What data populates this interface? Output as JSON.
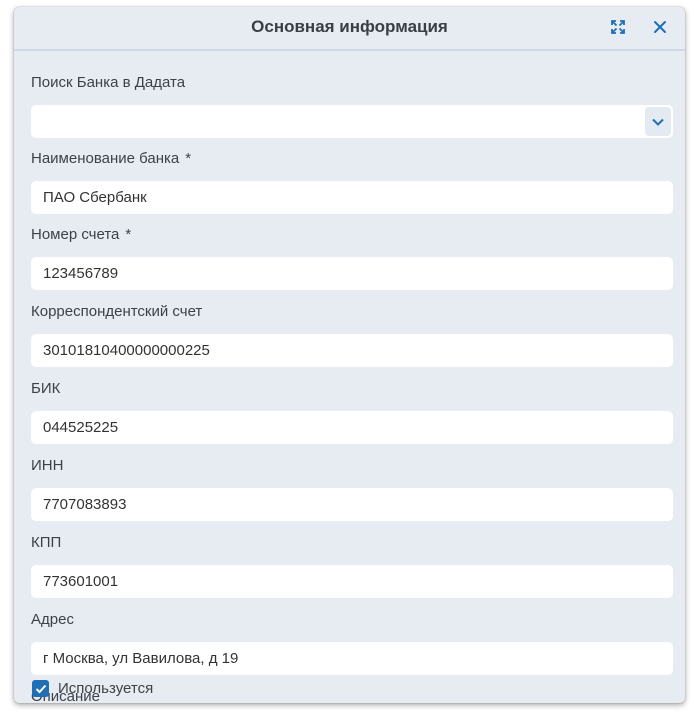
{
  "dialog": {
    "title": "Основная информация"
  },
  "form": {
    "bank_search": {
      "label": "Поиск Банка в Дадата",
      "value": ""
    },
    "bank_name": {
      "label": "Наименование банка",
      "required_mark": "*",
      "value": "ПАО Сбербанк"
    },
    "account_number": {
      "label": "Номер счета",
      "required_mark": "*",
      "value": "123456789"
    },
    "corr_account": {
      "label": "Корреспондентский счет",
      "value": "30101810400000000225"
    },
    "bik": {
      "label": "БИК",
      "value": "044525225"
    },
    "inn": {
      "label": "ИНН",
      "value": "7707083893"
    },
    "kpp": {
      "label": "КПП",
      "value": "773601001"
    },
    "address": {
      "label": "Адрес",
      "value": "г Москва, ул Вавилова, д 19"
    },
    "description": {
      "label": "Описание",
      "value": ""
    },
    "in_use": {
      "label": "Используется",
      "checked": true
    }
  },
  "icons": {
    "expand": "expand-icon",
    "close": "close-icon",
    "dropdown": "chevron-down-icon",
    "check": "check-icon"
  },
  "colors": {
    "accent": "#1f6fb5",
    "dialog_bg": "#e6ecf2",
    "input_bg": "#ffffff"
  }
}
